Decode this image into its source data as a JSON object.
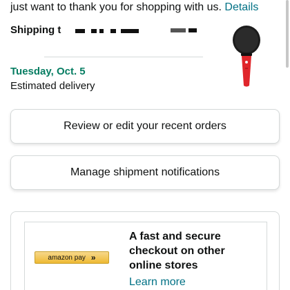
{
  "header": {
    "thank_text": "just want to thank you for shopping with us.",
    "details_link": "Details"
  },
  "shipping": {
    "label": "Shipping t"
  },
  "delivery": {
    "date": "Tuesday, Oct. 5",
    "subtitle": "Estimated delivery"
  },
  "product": {
    "icon": "karaoke-microphone-image",
    "colors": {
      "head": "#1c1c1c",
      "handle": "#e0262b"
    }
  },
  "actions": {
    "review_label": "Review or edit your recent orders",
    "notify_label": "Manage shipment notifications"
  },
  "promo": {
    "badge_text": "amazon pay",
    "badge_arrows": "»",
    "headline": "A fast and secure checkout on other online stores",
    "link": "Learn more"
  },
  "colors": {
    "link": "#007185",
    "delivery_green": "#067d62",
    "text": "#0f1111",
    "border": "#d5d9d9"
  }
}
